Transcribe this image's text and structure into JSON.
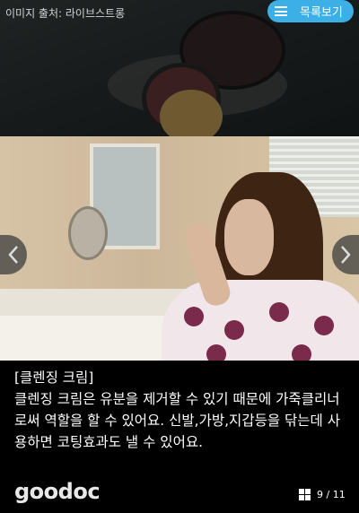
{
  "top": {
    "source_text": "이미지 출처: 라이브스트롱"
  },
  "list_button": {
    "label": "목록보기",
    "icon": "menu-icon"
  },
  "nav": {
    "prev_icon": "chevron-left-icon",
    "next_icon": "chevron-right-icon"
  },
  "caption": {
    "title": "[클렌징 크림]",
    "body": "클렌징 크림은 유분을 제거할 수 있기 때문에 가죽클리너로써 역할을 할 수 있어요. 신발,가방,지갑등을 닦는데 사용하면 코팅효과도 낼 수 있어요."
  },
  "footer": {
    "logo": "goodoc",
    "page_indicator": "9 / 11",
    "grid_icon": "grid-icon"
  },
  "colors": {
    "accent": "#3cb0e6",
    "background": "#000000"
  }
}
